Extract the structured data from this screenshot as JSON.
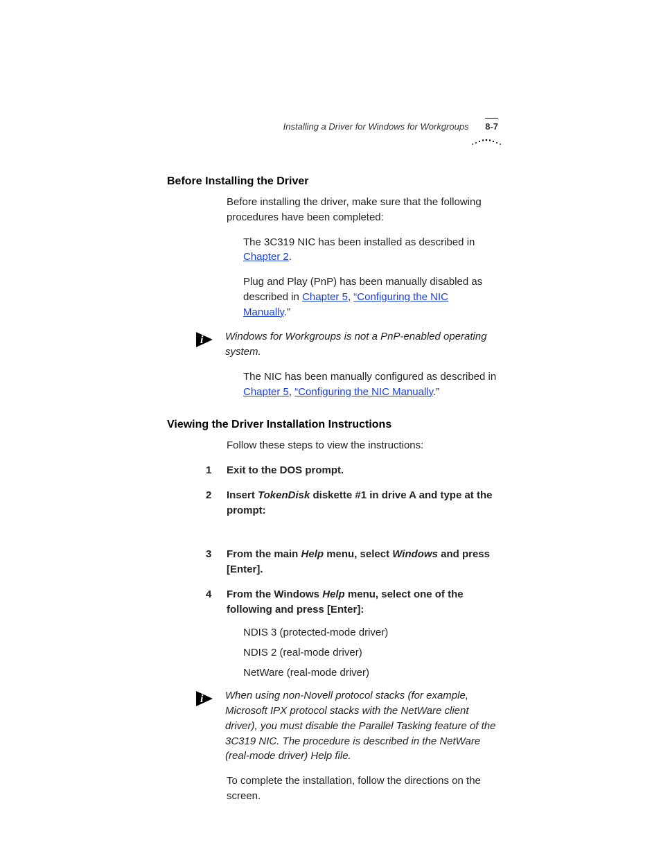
{
  "header": {
    "title": "Installing a Driver for Windows for Workgroups",
    "page_number": "8-7"
  },
  "section1": {
    "heading": "Before Installing the Driver",
    "intro": "Before installing the driver, make sure that the following procedures have been completed:",
    "bullet1_a": "The 3C319 NIC has been installed as described in ",
    "bullet1_link": "Chapter 2",
    "bullet1_b": ".",
    "bullet2_a": "Plug and Play (PnP) has been manually disabled as described in ",
    "bullet2_link1": "Chapter 5",
    "bullet2_mid": ", ",
    "bullet2_link2": "“Configuring the NIC Manually",
    "bullet2_b": ".”",
    "note": "Windows for Workgroups is not a PnP-enabled operating system.",
    "bullet3_a": "The NIC has been manually configured as described in ",
    "bullet3_link1": "Chapter 5",
    "bullet3_mid": ", ",
    "bullet3_link2": "“Configuring the NIC Manually",
    "bullet3_b": ".”"
  },
  "section2": {
    "heading": "Viewing the Driver Installation Instructions",
    "intro": "Follow these steps to view the instructions:",
    "step1": "Exit to the DOS prompt.",
    "step2_a": "Insert ",
    "step2_em": "TokenDisk",
    "step2_b": " diskette #1 in drive A and type at the prompt:",
    "step3_a": "From the main ",
    "step3_em1": "Help",
    "step3_b": " menu, select ",
    "step3_em2": "Windows",
    "step3_c": " and press [Enter].",
    "step4_a": "From the Windows ",
    "step4_em": "Help",
    "step4_b": " menu, select one of the following and press [Enter]:",
    "drivers": [
      "NDIS 3 (protected-mode driver)",
      "NDIS 2 (real-mode driver)",
      "NetWare (real-mode driver)"
    ],
    "note": "When using non-Novell protocol stacks (for example, Microsoft IPX protocol stacks with the NetWare client driver), you must disable the Parallel Tasking feature of the 3C319 NIC. The procedure is described in the NetWare (real-mode driver) Help file.",
    "closing": "To complete the installation, follow the directions on the screen."
  }
}
